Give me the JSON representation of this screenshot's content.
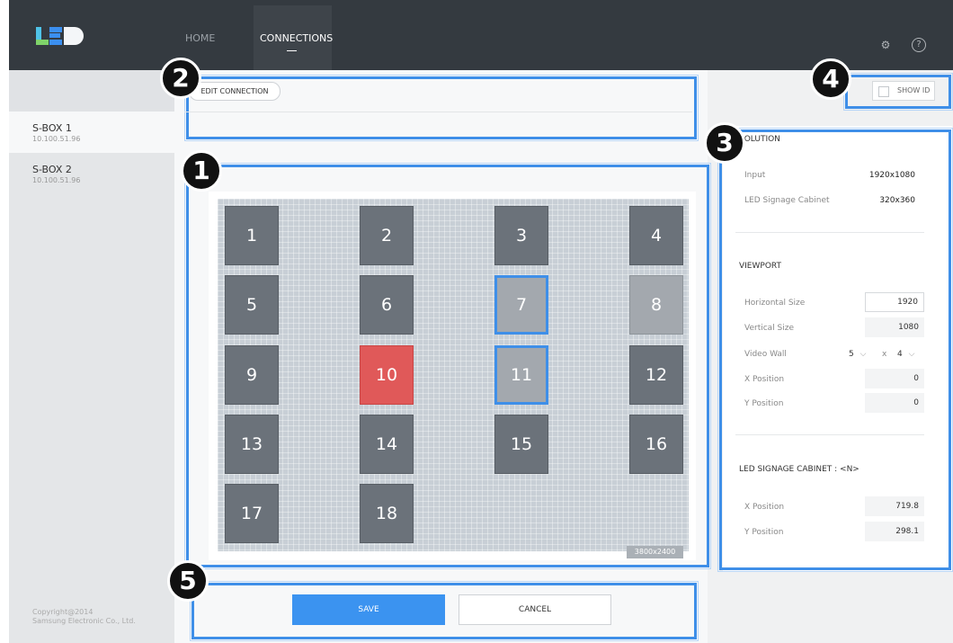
{
  "topbar": {
    "logo_text": "LED",
    "nav": [
      "HOME",
      "CONNECTIONS"
    ],
    "icons": [
      "gear-icon",
      "help-icon"
    ]
  },
  "sidebar": {
    "items": [
      {
        "name": "S-BOX 1",
        "ip": "10.100.51.96",
        "active": true
      },
      {
        "name": "S-BOX 2",
        "ip": "10.100.51.96",
        "active": false
      }
    ],
    "copyright_line1": "Copyright@2014",
    "copyright_line2": "Samsung Electronic Co., Ltd."
  },
  "toolbar": {
    "edit_connection": "EDIT CONNECTION",
    "show_id": "SHOW ID"
  },
  "canvas": {
    "resolution_badge": "3800x2400",
    "cabinets": [
      {
        "id": "1",
        "state": "normal"
      },
      {
        "id": "2",
        "state": "normal"
      },
      {
        "id": "3",
        "state": "normal"
      },
      {
        "id": "4",
        "state": "normal"
      },
      {
        "id": "5",
        "state": "normal"
      },
      {
        "id": "6",
        "state": "normal"
      },
      {
        "id": "7",
        "state": "selected"
      },
      {
        "id": "8",
        "state": "light"
      },
      {
        "id": "9",
        "state": "normal"
      },
      {
        "id": "10",
        "state": "error"
      },
      {
        "id": "11",
        "state": "selected"
      },
      {
        "id": "12",
        "state": "normal"
      },
      {
        "id": "13",
        "state": "normal"
      },
      {
        "id": "14",
        "state": "normal"
      },
      {
        "id": "15",
        "state": "normal"
      },
      {
        "id": "16",
        "state": "normal"
      },
      {
        "id": "17",
        "state": "normal"
      },
      {
        "id": "18",
        "state": "normal"
      }
    ]
  },
  "resolution": {
    "heading": "SOLUTION",
    "input_label": "Input",
    "input_value": "1920x1080",
    "cabinet_label": "LED Signage Cabinet",
    "cabinet_value": "320x360"
  },
  "viewport": {
    "heading": "VIEWPORT",
    "horizontal_label": "Horizontal Size",
    "horizontal_value": "1920",
    "vertical_label": "Vertical Size",
    "vertical_value": "1080",
    "videowall_label": "Video Wall",
    "videowall_cols": "5",
    "videowall_x": "x",
    "videowall_rows": "4",
    "xpos_label": "X Position",
    "xpos_value": "0",
    "ypos_label": "Y Position",
    "ypos_value": "0"
  },
  "cabinet_info": {
    "heading": "LED SIGNAGE CABINET : <N>",
    "xpos_label": "X Position",
    "xpos_value": "719.8",
    "ypos_label": "Y Position",
    "ypos_value": "298.1"
  },
  "actions": {
    "save": "SAVE",
    "cancel": "CANCEL"
  },
  "annotations": [
    "1",
    "2",
    "3",
    "4",
    "5"
  ],
  "colors": {
    "accent": "#3f8fe8",
    "error_cabinet": "#e05959",
    "topbar": "#343a40"
  }
}
